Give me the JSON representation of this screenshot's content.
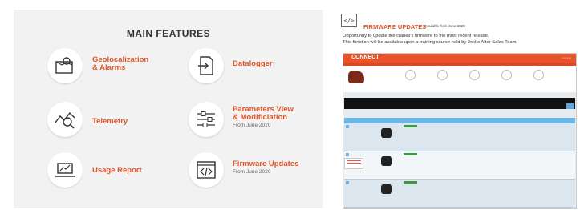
{
  "left_panel": {
    "title": "MAIN FEATURES",
    "features": [
      {
        "label": "Geolocalization\n& Alarms",
        "sub": "",
        "icon": "map-pin-icon"
      },
      {
        "label": "Datalogger",
        "sub": "",
        "icon": "file-import-icon"
      },
      {
        "label": "Telemetry",
        "sub": "",
        "icon": "analytics-icon"
      },
      {
        "label": "Parameters View\n& Modificiation",
        "sub": "From June 2020",
        "icon": "sliders-icon"
      },
      {
        "label": "Usage Report",
        "sub": "",
        "icon": "laptop-chart-icon"
      },
      {
        "label": "Firmware Updates",
        "sub": "From June 2020",
        "icon": "code-window-icon"
      }
    ]
  },
  "right_panel": {
    "icon_text": "</>",
    "title": "FIRMWARE UPDATES",
    "available": "Available from June 2020",
    "desc_line1": "Opportunity to update the cranes's firmware to the most recent release.",
    "desc_line2": "This function will be available upon a training course held by Jekko After Sales Team.",
    "screenshot": {
      "logo": "CONNECT",
      "menu": "▪ ▪ ▪ ▪ ▪ ▪ ▪"
    }
  }
}
